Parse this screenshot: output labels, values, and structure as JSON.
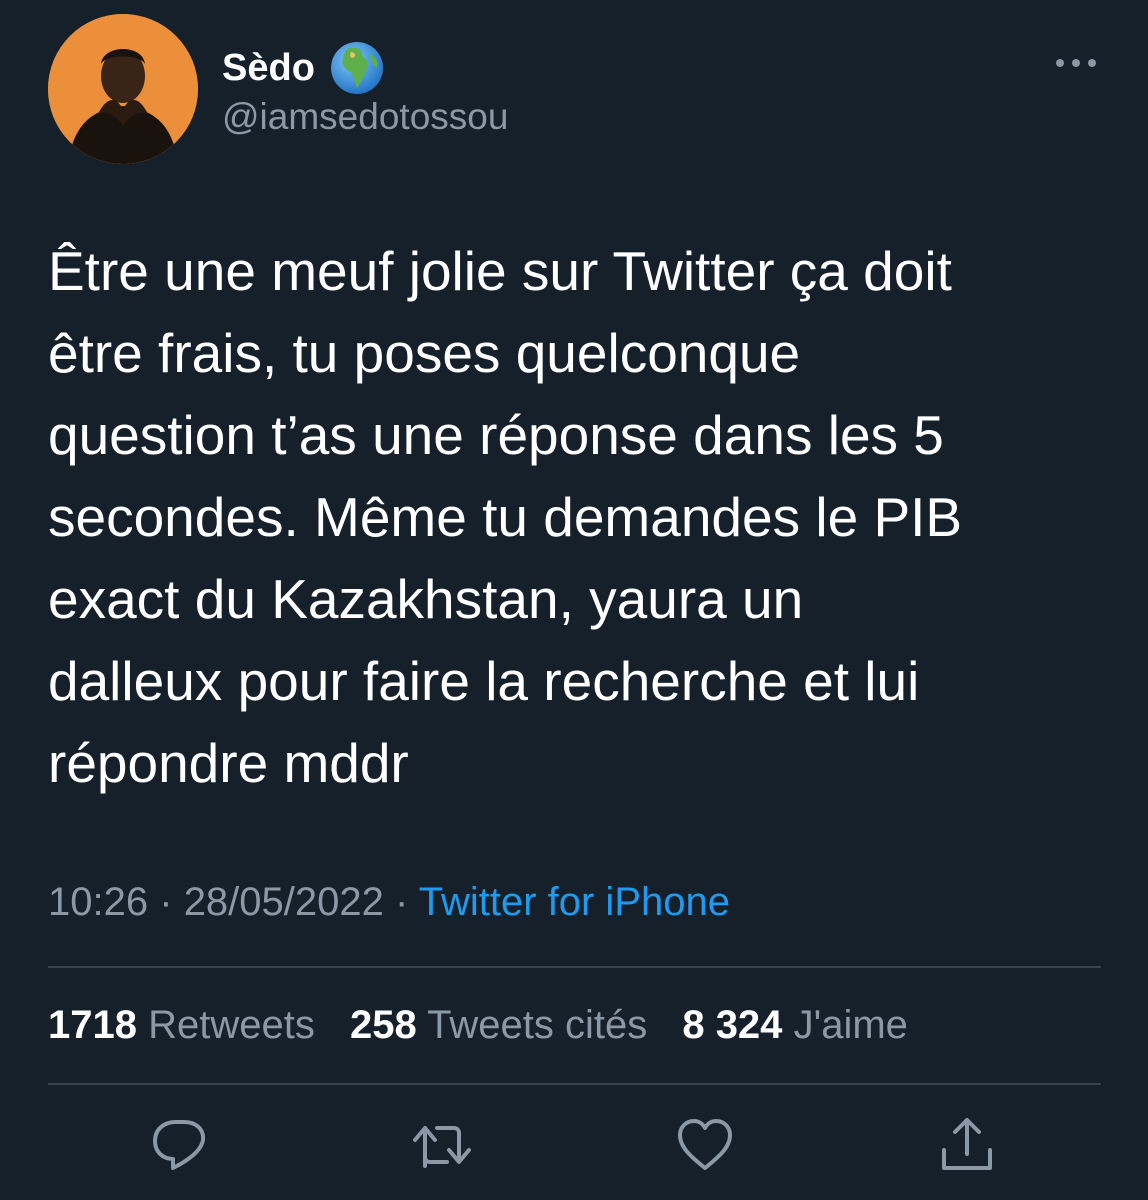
{
  "author": {
    "display_name": "Sèdo",
    "handle": "@iamsedotossou",
    "badge_icon": "globe-africa-icon"
  },
  "tweet": {
    "lines": [
      "Être une meuf jolie sur Twitter ça doit",
      "être frais, tu poses quelconque",
      "question t’as une réponse dans les 5",
      "secondes. Même tu demandes le PIB",
      "exact du Kazakhstan, yaura un",
      "dalleux pour faire la recherche et lui",
      "répondre mddr"
    ]
  },
  "meta": {
    "time": "10:26",
    "separator": "·",
    "date": "28/05/2022",
    "source": "Twitter for iPhone"
  },
  "stats": {
    "retweets_count": "1718",
    "retweets_label": "Retweets",
    "quotes_count": "258",
    "quotes_label": "Tweets cités",
    "likes_count": "8 324",
    "likes_label": "J'aime"
  },
  "actions": [
    "reply-icon",
    "retweet-icon",
    "like-icon",
    "share-icon"
  ],
  "colors": {
    "background": "#15202b",
    "text": "#ffffff",
    "secondary": "#8b98a5",
    "link": "#1d9bf0",
    "divider": "#38444d"
  }
}
